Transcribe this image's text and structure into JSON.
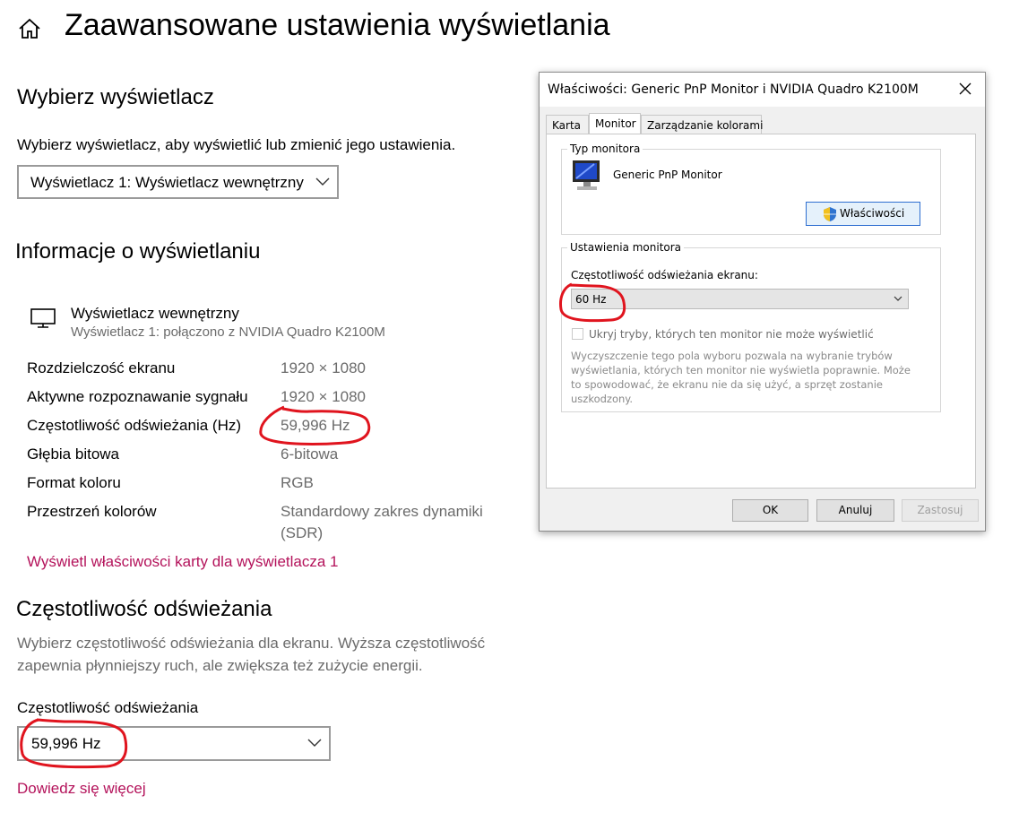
{
  "page": {
    "title": "Zaawansowane ustawienia wyświetlania",
    "select_display": {
      "heading": "Wybierz wyświetlacz",
      "description": "Wybierz wyświetlacz, aby wyświetlić lub zmienić jego ustawienia.",
      "dropdown_value": "Wyświetlacz 1: Wyświetlacz wewnętrzny"
    },
    "display_info": {
      "heading": "Informacje o wyświetlaniu",
      "display_name": "Wyświetlacz wewnętrzny",
      "display_sub": "Wyświetlacz 1: połączono z NVIDIA Quadro K2100M",
      "rows": [
        {
          "label": "Rozdzielczość ekranu",
          "value": "1920 × 1080"
        },
        {
          "label": "Aktywne rozpoznawanie sygnału",
          "value": "1920 × 1080"
        },
        {
          "label": "Częstotliwość odświeżania (Hz)",
          "value": "59,996 Hz"
        },
        {
          "label": "Głębia bitowa",
          "value": "6-bitowa"
        },
        {
          "label": "Format koloru",
          "value": "RGB"
        },
        {
          "label": "Przestrzeń kolorów",
          "value": "Standardowy zakres dynamiki",
          "value2": "(SDR)"
        }
      ],
      "adapter_link": "Wyświetl właściwości karty dla wyświetlacza 1"
    },
    "refresh": {
      "heading": "Częstotliwość odświeżania",
      "description_line1": "Wybierz częstotliwość odświeżania dla ekranu. Wyższa częstotliwość",
      "description_line2": "zapewnia płynniejszy ruch, ale zwiększa też zużycie energii.",
      "field_label": "Częstotliwość odświeżania",
      "dropdown_value": "59,996 Hz",
      "learn_more": "Dowiedz się więcej"
    }
  },
  "dialog": {
    "title": "Właściwości: Generic PnP Monitor i NVIDIA Quadro K2100M",
    "tabs": [
      "Karta",
      "Monitor",
      "Zarządzanie kolorami"
    ],
    "active_tab": "Monitor",
    "monitor_type": {
      "legend": "Typ monitora",
      "name": "Generic PnP Monitor",
      "properties_button": "Właściwości"
    },
    "monitor_settings": {
      "legend": "Ustawienia monitora",
      "refresh_label": "Częstotliwość odświeżania ekranu:",
      "refresh_value": "60 Hz",
      "hide_modes_label": "Ukryj tryby, których ten monitor nie może wyświetlić",
      "help_lines": [
        "Wyczyszczenie tego pola wyboru pozwala na wybranie trybów",
        "wyświetlania, których ten monitor nie wyświetla poprawnie. Może",
        "to spowodować, że ekranu nie da się użyć, a sprzęt zostanie",
        "uszkodzony."
      ]
    },
    "buttons": {
      "ok": "OK",
      "cancel": "Anuluj",
      "apply": "Zastosuj"
    }
  },
  "colors": {
    "link": "#b4135b",
    "annotation": "#e0141e",
    "muted": "#6b6b6b"
  },
  "icons": [
    "home-icon",
    "monitor-icon",
    "chevron-down-icon",
    "close-icon",
    "crt-monitor-icon",
    "uac-shield-icon"
  ]
}
